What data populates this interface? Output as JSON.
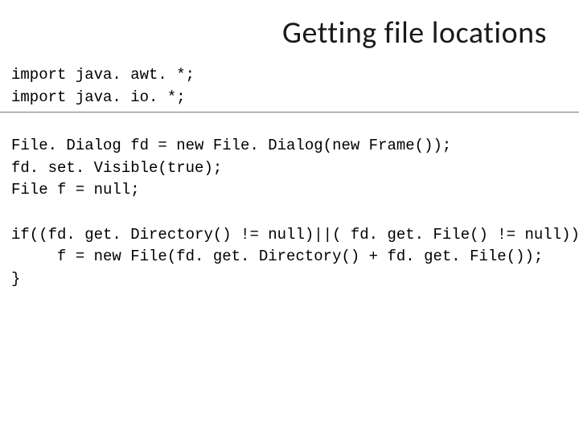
{
  "title": "Getting file locations",
  "code": {
    "block1_l1": "import java. awt. *;",
    "block1_l2": "import java. io. *;",
    "block2_l1": "File. Dialog fd = new File. Dialog(new Frame());",
    "block2_l2": "fd. set. Visible(true);",
    "block2_l3": "File f = null;",
    "block3_l1": "if((fd. get. Directory() != null)||( fd. get. File() != null)) {",
    "block3_l2": "     f = new File(fd. get. Directory() + fd. get. File());",
    "block3_l3": "}"
  }
}
